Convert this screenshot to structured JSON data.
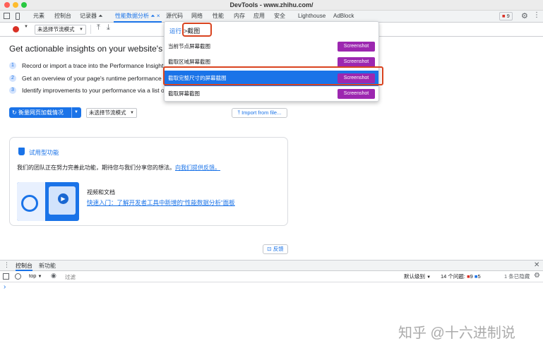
{
  "window": {
    "title": "DevTools - www.zhihu.com/"
  },
  "tabs": [
    {
      "label": "元素"
    },
    {
      "label": "控制台"
    },
    {
      "label": "记录器 ⏶"
    },
    {
      "label": "性能数据分析 ⏶"
    },
    {
      "label": "源代码"
    },
    {
      "label": "网络"
    },
    {
      "label": "性能"
    },
    {
      "label": "内存"
    },
    {
      "label": "应用"
    },
    {
      "label": "安全"
    },
    {
      "label": "Lighthouse"
    },
    {
      "label": "AdBlock"
    }
  ],
  "tab_close": "×",
  "issues_badge": {
    "count": "9"
  },
  "toolbar": {
    "throttle_label": "未选择节流模式"
  },
  "main": {
    "heading": "Get actionable insights on your website's per",
    "steps": [
      {
        "num": "1",
        "text": "Record or import a trace into the Performance Insight"
      },
      {
        "num": "2",
        "text": "Get an overview of your page's runtime performance"
      },
      {
        "num": "3",
        "text": "Identify improvements to your performance via a list o"
      }
    ],
    "measure_button": "衡量网页加载情况",
    "throttle_select": "未选择节流模式",
    "import_button": "Import from file...",
    "card": {
      "title": "试用型功能",
      "desc": "我们的团队正在努力完善此功能，期待您与我们分享您的想法。",
      "feedback_link": "向我们提供反馈。",
      "video_label": "视频和文档",
      "video_link": "快速入门：了解开发者工具中新增的“性能数据分析”面板"
    },
    "feedback_button": "反馈"
  },
  "command_menu": {
    "prefix": "运行",
    "query": ">截图",
    "items": [
      {
        "label": "当前节点屏幕截图",
        "action": "Screenshot",
        "selected": false
      },
      {
        "label": "截取区域屏幕截图",
        "action": "Screenshot",
        "selected": false
      },
      {
        "label": "截取完整尺寸的屏幕截图",
        "action": "Screenshot",
        "selected": true
      },
      {
        "label": "截取屏幕截图",
        "action": "Screenshot",
        "selected": false
      }
    ]
  },
  "drawer": {
    "tabs": [
      {
        "label": "控制台"
      },
      {
        "label": "新功能"
      }
    ],
    "context": "top",
    "filter_placeholder": "过滤",
    "levels": "默认级别",
    "issues_label": "14 个问题:",
    "issues_errors": "9",
    "issues_warnings": "5",
    "hidden": "1 条已隐藏",
    "prompt": "›"
  },
  "watermark": "知乎 @十六进制说",
  "colors": {
    "accent": "#1a73e8",
    "screenshot": "#9c27b0",
    "highlight_outline": "#d9431f"
  }
}
